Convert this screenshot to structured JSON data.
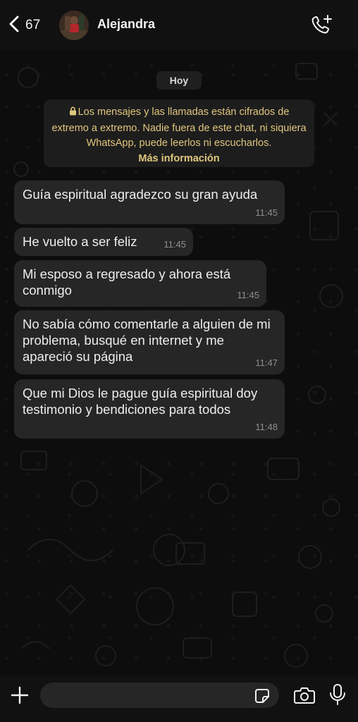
{
  "header": {
    "back_count": "67",
    "contact_name": "Alejandra"
  },
  "date_chip": "Hoy",
  "encryption_notice": {
    "text": "Los mensajes y las llamadas están cifrados de extremo a extremo. Nadie fuera de este chat, ni siquiera WhatsApp, puede leerlos ni escucharlos.",
    "link": "Más información"
  },
  "messages": [
    {
      "text": "Guía espiritual agradezco su gran ayuda",
      "time": "11:45"
    },
    {
      "text": "He vuelto a ser feliz",
      "time": "11:45"
    },
    {
      "text": "Mi esposo a regresado y ahora está conmigo",
      "time": "11:45"
    },
    {
      "text": "No sabía cómo comentarle a alguien de mi problema, busqué en internet y me apareció su página",
      "time": "11:47"
    },
    {
      "text": "Que mi Dios le pague guía espiritual doy testimonio y bendiciones para todos",
      "time": "11:48"
    }
  ],
  "composer": {
    "placeholder": ""
  },
  "icons": {
    "back": "chevron-left-icon",
    "call": "add-call-icon",
    "plus": "plus-icon",
    "sticker": "sticker-icon",
    "camera": "camera-icon",
    "mic": "microphone-icon",
    "lock": "lock-icon"
  },
  "colors": {
    "background": "#0d0d0d",
    "bubble": "#262626",
    "notice_text": "#e0c77e",
    "time_text": "#8f8f8f"
  }
}
